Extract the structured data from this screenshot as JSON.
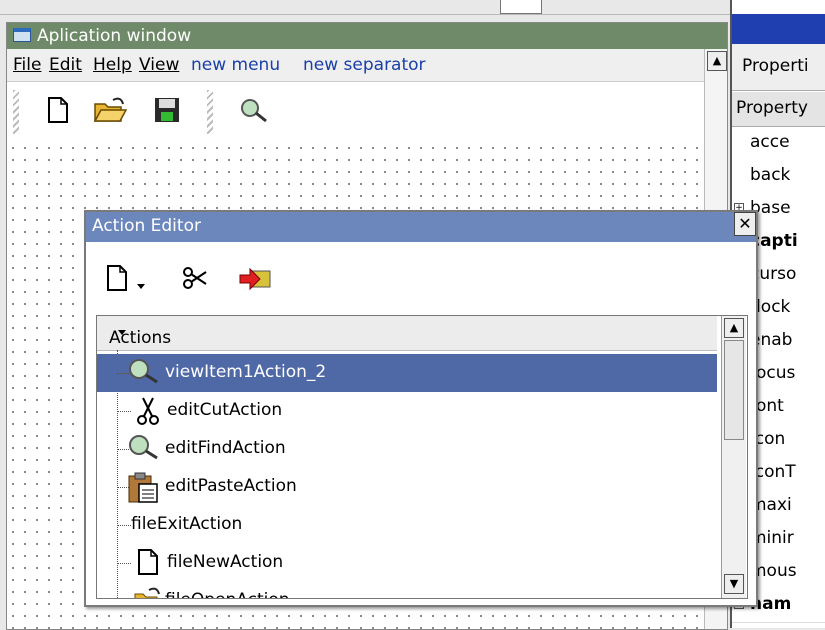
{
  "app_window": {
    "title": "Aplication window",
    "menu": [
      {
        "label": "File",
        "mnemonic": true
      },
      {
        "label": "Edit",
        "mnemonic": true
      },
      {
        "label": "Help",
        "mnemonic": true
      },
      {
        "label": "View",
        "mnemonic": true
      },
      {
        "label": "new menu",
        "mnemonic": false
      },
      {
        "label": "new separator",
        "mnemonic": false
      }
    ],
    "toolbar_icons": [
      "new-file-icon",
      "open-folder-icon",
      "save-icon",
      "search-icon"
    ]
  },
  "action_editor": {
    "title": "Action Editor",
    "close_glyph": "✕",
    "toolbar_icons": [
      "new-action-icon",
      "dropdown-arrow-icon",
      "cut-icon",
      "connect-icon"
    ],
    "list_header": "Actions",
    "actions": [
      {
        "label": "viewItem1Action_2",
        "icon": "search-icon",
        "selected": true
      },
      {
        "label": "editCutAction",
        "icon": "scissors-icon",
        "selected": false
      },
      {
        "label": "editFindAction",
        "icon": "search-icon",
        "selected": false
      },
      {
        "label": "editPasteAction",
        "icon": "paste-icon",
        "selected": false
      },
      {
        "label": "fileExitAction",
        "icon": "",
        "selected": false
      },
      {
        "label": "fileNewAction",
        "icon": "new-file-icon",
        "selected": false
      },
      {
        "label": "fileOpenAction",
        "icon": "open-folder-icon",
        "selected": false
      }
    ]
  },
  "property_panel": {
    "tab_label": "Properti",
    "header": "Property",
    "rows": [
      {
        "label": "acce",
        "expandable": false,
        "bold": false
      },
      {
        "label": "back",
        "expandable": false,
        "bold": false
      },
      {
        "label": "base",
        "expandable": true,
        "bold": false
      },
      {
        "label": "capti",
        "expandable": true,
        "bold": true
      },
      {
        "label": "curso",
        "expandable": false,
        "bold": false
      },
      {
        "label": "dock",
        "expandable": false,
        "bold": false
      },
      {
        "label": "enab",
        "expandable": false,
        "bold": false
      },
      {
        "label": "focus",
        "expandable": false,
        "bold": false
      },
      {
        "label": "font",
        "expandable": true,
        "bold": false
      },
      {
        "label": "icon",
        "expandable": false,
        "bold": false
      },
      {
        "label": "iconT",
        "expandable": true,
        "bold": false
      },
      {
        "label": "maxi",
        "expandable": true,
        "bold": false
      },
      {
        "label": "minir",
        "expandable": true,
        "bold": false
      },
      {
        "label": "mous",
        "expandable": false,
        "bold": false
      },
      {
        "label": "nam",
        "expandable": true,
        "bold": true
      }
    ]
  },
  "colors": {
    "app_title_bg": "#6f8a69",
    "editor_title_bg": "#6b87bc",
    "selection_bg": "#4f68a6",
    "menu_blue": "#1a3fa8",
    "prop_title_bg": "#1f3fb0"
  }
}
